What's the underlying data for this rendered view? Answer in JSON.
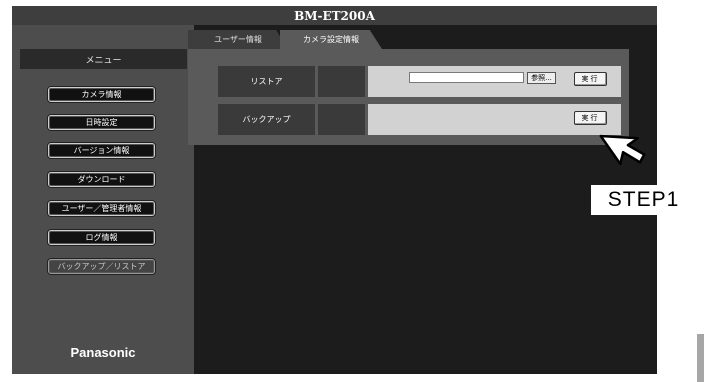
{
  "window": {
    "title": "BM-ET200A"
  },
  "sidebar": {
    "menu_header": "メニュー",
    "items": [
      {
        "label": "カメラ情報"
      },
      {
        "label": "日時設定"
      },
      {
        "label": "バージョン情報"
      },
      {
        "label": "ダウンロード"
      },
      {
        "label": "ユーザー／管理者情報"
      },
      {
        "label": "ログ情報"
      },
      {
        "label": "バックアップ／リストア"
      }
    ],
    "brand": "Panasonic"
  },
  "tabs": [
    {
      "label": "ユーザー情報"
    },
    {
      "label": "カメラ設定情報"
    }
  ],
  "panel": {
    "restore": {
      "label": "リストア",
      "file_value": "",
      "browse_label": "参照...",
      "exec_label": "実行"
    },
    "backup": {
      "label": "バックアップ",
      "exec_label": "実行"
    }
  },
  "annotation": {
    "step_label": "STEP1"
  },
  "icons": {
    "cursor": "arrow-cursor-icon"
  },
  "colors": {
    "titlebar": "#3e3e3e",
    "sidebar": "#4d4d4d",
    "panel": "#5a5a5a",
    "content_bg": "#1c1c1c",
    "cell_light": "#d2d2d2"
  }
}
